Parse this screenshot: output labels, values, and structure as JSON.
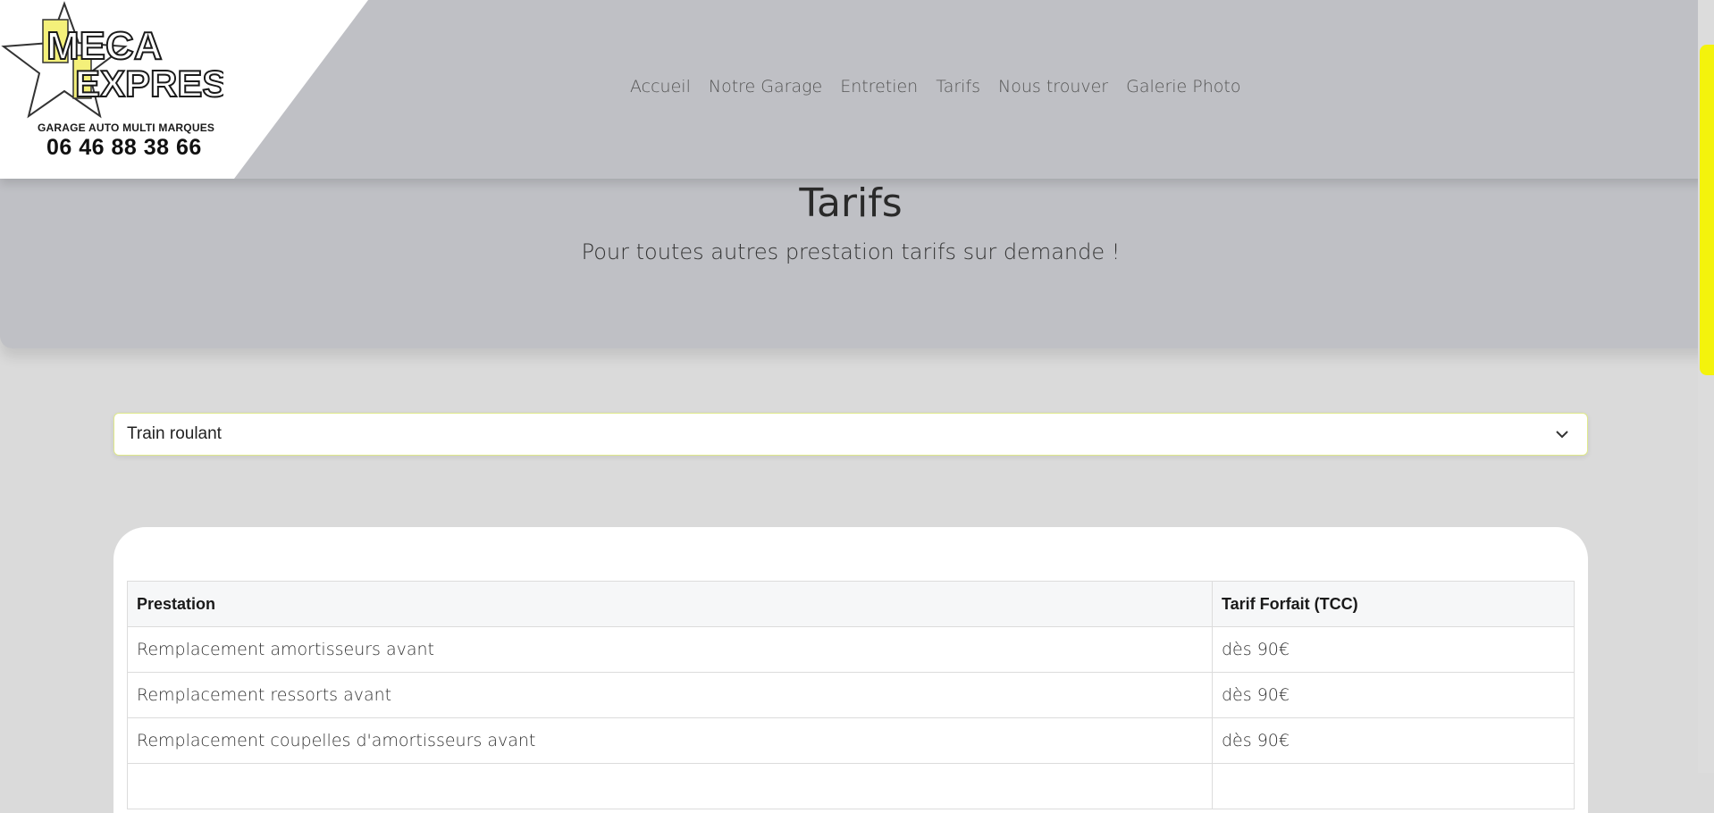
{
  "logo": {
    "brand_line1": "MECA",
    "brand_line2": "EXPRESS",
    "subtitle": "GARAGE AUTO MULTI MARQUES",
    "phone": "06 46 88 38 66"
  },
  "nav": {
    "items": [
      {
        "label": "Accueil"
      },
      {
        "label": "Notre Garage"
      },
      {
        "label": "Entretien"
      },
      {
        "label": "Tarifs"
      },
      {
        "label": "Nous trouver"
      },
      {
        "label": "Galerie Photo"
      }
    ]
  },
  "hero": {
    "title": "Tarifs",
    "subtitle": "Pour toutes autres prestation tarifs sur demande !"
  },
  "category_select": {
    "selected": "Train roulant"
  },
  "table": {
    "headers": [
      "Prestation",
      "Tarif Forfait (TCC)"
    ],
    "rows": [
      {
        "prestation": "Remplacement amortisseurs avant",
        "tarif": "dès 90€"
      },
      {
        "prestation": "Remplacement ressorts avant",
        "tarif": "dès 90€"
      },
      {
        "prestation": "Remplacement coupelles d'amortisseurs avant",
        "tarif": "dès 90€"
      },
      {
        "prestation": "",
        "tarif": ""
      }
    ]
  },
  "colors": {
    "header_bg": "#bfc0c5",
    "page_bg": "#dadada",
    "accent_yellow": "#f4f30c"
  }
}
